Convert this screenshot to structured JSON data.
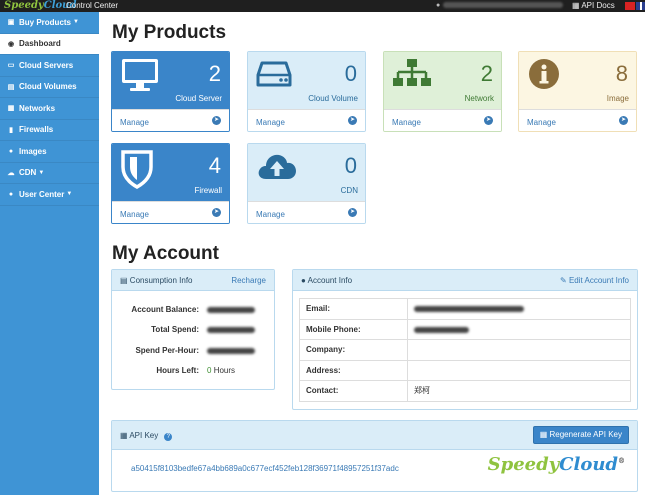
{
  "topbar": {
    "logo_a": "Speedy",
    "logo_b": "Cloud",
    "title": "Control Center",
    "api_docs": "API Docs"
  },
  "sidebar": {
    "items": [
      {
        "label": "Buy Products",
        "icon": "cart-icon"
      },
      {
        "label": "Dashboard",
        "icon": "dashboard-icon"
      },
      {
        "label": "Cloud Servers",
        "icon": "monitor-icon"
      },
      {
        "label": "Cloud Volumes",
        "icon": "disk-icon"
      },
      {
        "label": "Networks",
        "icon": "sitemap-icon"
      },
      {
        "label": "Firewalls",
        "icon": "shield-icon"
      },
      {
        "label": "Images",
        "icon": "info-icon"
      },
      {
        "label": "CDN",
        "icon": "cloud-icon"
      },
      {
        "label": "User Center",
        "icon": "user-icon"
      }
    ]
  },
  "products": {
    "heading": "My Products",
    "manage_label": "Manage",
    "cards": [
      {
        "count": "2",
        "label": "Cloud Server",
        "icon": "monitor-icon",
        "color": "#3a85c9"
      },
      {
        "count": "0",
        "label": "Cloud Volume",
        "icon": "disk-icon",
        "color": "#daedf8"
      },
      {
        "count": "2",
        "label": "Network",
        "icon": "sitemap-icon",
        "color": "#dff0d8"
      },
      {
        "count": "8",
        "label": "Image",
        "icon": "info-icon",
        "color": "#fcf6e2"
      },
      {
        "count": "4",
        "label": "Firewall",
        "icon": "shield-icon",
        "color": "#3a85c9"
      },
      {
        "count": "0",
        "label": "CDN",
        "icon": "cloud-upload-icon",
        "color": "#daedf8"
      }
    ]
  },
  "account": {
    "heading": "My Account",
    "consumption": {
      "title": "Consumption Info",
      "link": "Recharge",
      "rows": [
        {
          "key": "Account Balance:",
          "value": ""
        },
        {
          "key": "Total Spend:",
          "value": ""
        },
        {
          "key": "Spend Per-Hour:",
          "value": ""
        },
        {
          "key": "Hours Left:",
          "value": "0",
          "unit": "Hours"
        }
      ]
    },
    "info": {
      "title": "Account Info",
      "link": "Edit Account Info",
      "rows": [
        {
          "key": "Email:",
          "value": ""
        },
        {
          "key": "Mobile Phone:",
          "value": ""
        },
        {
          "key": "Company:",
          "value": ""
        },
        {
          "key": "Address:",
          "value": ""
        },
        {
          "key": "Contact:",
          "value": "郑柯"
        }
      ]
    }
  },
  "api": {
    "title": "API Key",
    "help": "?",
    "button": "Regenerate API Key",
    "key": "a50415f8103bedfe67a4bb689a0c677ecf452feb128f36971f48957251f37adc",
    "brand_a": "Speedy",
    "brand_b": "Cloud",
    "brand_mark": "®"
  }
}
